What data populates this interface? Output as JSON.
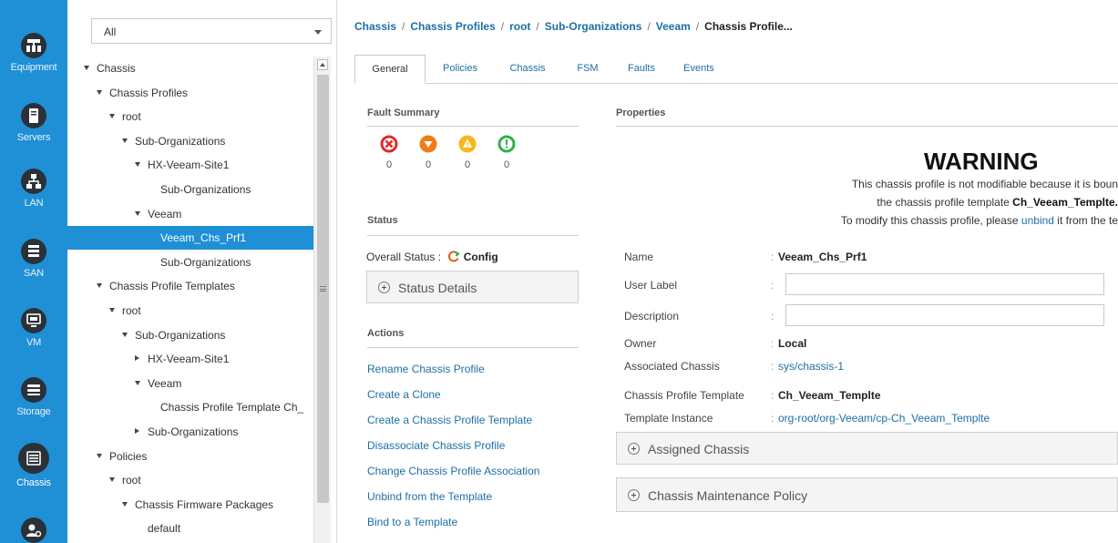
{
  "rail": [
    {
      "label": "Equipment",
      "icon": "equipment-icon"
    },
    {
      "label": "Servers",
      "icon": "servers-icon"
    },
    {
      "label": "LAN",
      "icon": "lan-icon"
    },
    {
      "label": "SAN",
      "icon": "san-icon"
    },
    {
      "label": "VM",
      "icon": "vm-icon"
    },
    {
      "label": "Storage",
      "icon": "storage-icon"
    },
    {
      "label": "Chassis",
      "icon": "chassis-icon",
      "active": true
    },
    {
      "label": "",
      "icon": "admin-icon"
    }
  ],
  "nav": {
    "filter_value": "All",
    "tree": [
      {
        "label": "Chassis",
        "toggle": "down"
      },
      {
        "label": "Chassis Profiles",
        "toggle": "down"
      },
      {
        "label": "root",
        "toggle": "down"
      },
      {
        "label": "Sub-Organizations",
        "toggle": "down"
      },
      {
        "label": "HX-Veeam-Site1",
        "toggle": "down"
      },
      {
        "label": "Sub-Organizations",
        "toggle": "none"
      },
      {
        "label": "Veeam",
        "toggle": "down"
      },
      {
        "label": "Veeam_Chs_Prf1",
        "toggle": "none",
        "selected": true
      },
      {
        "label": "Sub-Organizations",
        "toggle": "none"
      },
      {
        "label": "Chassis Profile Templates",
        "toggle": "down"
      },
      {
        "label": "root",
        "toggle": "down"
      },
      {
        "label": "Sub-Organizations",
        "toggle": "down"
      },
      {
        "label": "HX-Veeam-Site1",
        "toggle": "right"
      },
      {
        "label": "Veeam",
        "toggle": "down"
      },
      {
        "label": "Chassis Profile Template Ch_",
        "toggle": "none"
      },
      {
        "label": "Sub-Organizations",
        "toggle": "right"
      },
      {
        "label": "Policies",
        "toggle": "down"
      },
      {
        "label": "root",
        "toggle": "down"
      },
      {
        "label": "Chassis Firmware Packages",
        "toggle": "down"
      },
      {
        "label": "default",
        "toggle": "none"
      }
    ]
  },
  "breadcrumb": [
    "Chassis",
    "Chassis Profiles",
    "root",
    "Sub-Organizations",
    "Veeam",
    "Chassis Profile..."
  ],
  "tabs": [
    "General",
    "Policies",
    "Chassis",
    "FSM",
    "Faults",
    "Events"
  ],
  "fault_summary": {
    "title": "Fault Summary",
    "items": [
      {
        "icon": "critical-fault-icon",
        "count": "0",
        "color": "#e02a2a"
      },
      {
        "icon": "major-fault-icon",
        "count": "0",
        "color": "#f07d1a"
      },
      {
        "icon": "minor-fault-icon",
        "count": "0",
        "color": "#f5b81c"
      },
      {
        "icon": "warning-fault-icon",
        "count": "0",
        "color": "#2eb14a"
      }
    ]
  },
  "status": {
    "title": "Status",
    "overall_label": "Overall Status :",
    "overall_value": "Config",
    "details_label": "Status Details"
  },
  "actions": {
    "title": "Actions",
    "items": [
      "Rename Chassis Profile",
      "Create a Clone",
      "Create a Chassis Profile Template",
      "Disassociate Chassis Profile",
      "Change Chassis Profile Association",
      "Unbind from the Template",
      "Bind to a Template"
    ]
  },
  "properties": {
    "title": "Properties",
    "warning_title": "WARNING",
    "warning_line1": "This chassis profile is not modifiable because it is boun",
    "warning_line2_pre": "the chassis profile template ",
    "warning_line2_bold": "Ch_Veeam_Templte.",
    "warning_line3_pre": "To modify this chassis profile, please ",
    "warning_line3_link": "unbind",
    "warning_line3_post": " it from the te",
    "name_label": "Name",
    "name_value": "Veeam_Chs_Prf1",
    "user_label_label": "User Label",
    "user_label_value": "",
    "description_label": "Description",
    "description_value": "",
    "owner_label": "Owner",
    "owner_value": "Local",
    "assoc_label": "Associated Chassis",
    "assoc_value": "sys/chassis-1",
    "template_label": "Chassis Profile Template",
    "template_value": "Ch_Veeam_Templte",
    "instance_label": "Template Instance",
    "instance_value": "org-root/org-Veeam/cp-Ch_Veeam_Templte",
    "assigned_chassis_label": "Assigned Chassis",
    "maintenance_label": "Chassis Maintenance Policy"
  },
  "colors": {
    "accent": "#1f8fd6",
    "link": "#1d6fa5"
  }
}
